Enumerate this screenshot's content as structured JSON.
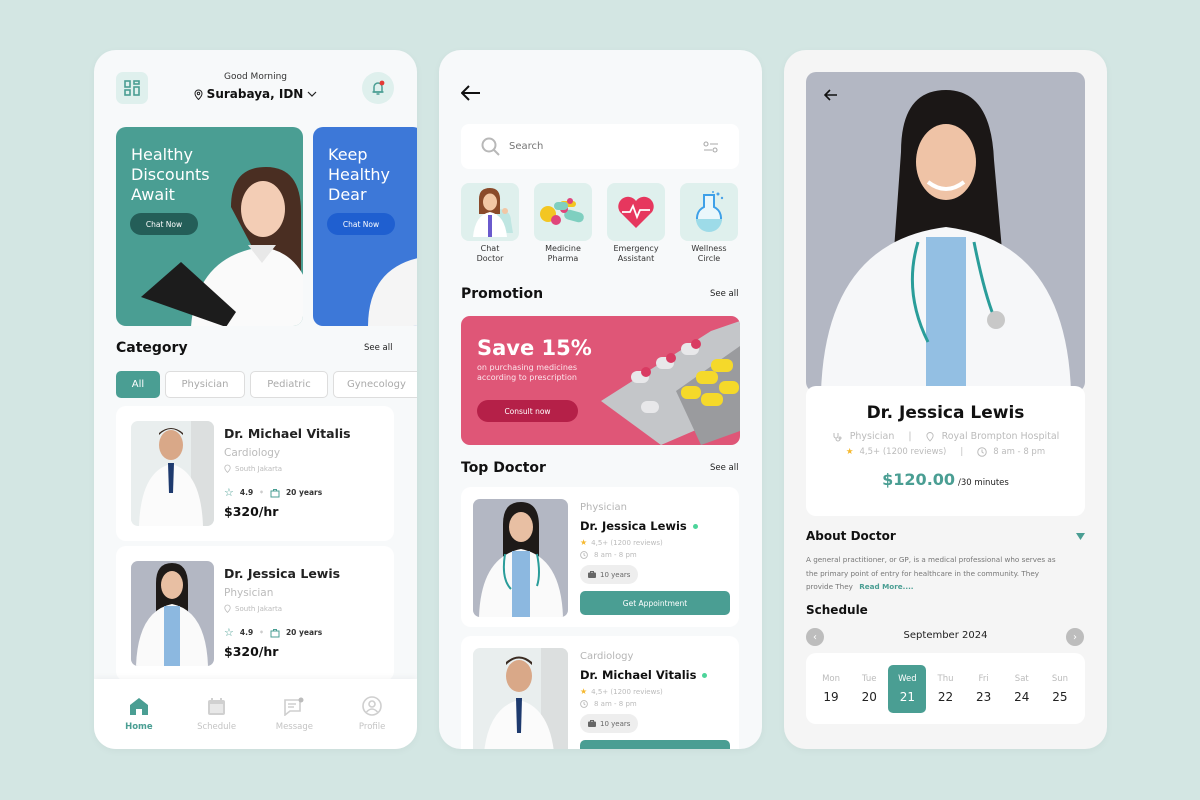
{
  "colors": {
    "background": "#d3e6e3",
    "primary": "#4a9e93",
    "blue_banner": "#3d78d8",
    "promo": "#df5677",
    "star": "#f5b82e",
    "online": "#4cd49a"
  },
  "home": {
    "greeting": "Good Morning",
    "location": "Surabaya, IDN",
    "banners": [
      {
        "title": "Healthy Discounts Await",
        "button": "Chat Now"
      },
      {
        "title": "Keep Healthy Dear",
        "button": "Chat Now"
      }
    ],
    "category_title": "Category",
    "see_all": "See all",
    "chips": [
      "All",
      "Physician",
      "Pediatric",
      "Gynecology"
    ],
    "doctors": [
      {
        "name": "Dr. Michael Vitalis",
        "specialty": "Cardiology",
        "location": "South Jakarta",
        "rating": "4.9",
        "experience": "20 years",
        "price": "$320/hr"
      },
      {
        "name": "Dr. Jessica Lewis",
        "specialty": "Physician",
        "location": "South Jakarta",
        "rating": "4.9",
        "experience": "20 years",
        "price": "$320/hr"
      }
    ],
    "nav": [
      {
        "label": "Home",
        "icon": "home-icon",
        "active": true
      },
      {
        "label": "Schedule",
        "icon": "calendar-icon"
      },
      {
        "label": "Message",
        "icon": "message-icon"
      },
      {
        "label": "Profile",
        "icon": "profile-icon"
      }
    ]
  },
  "search_screen": {
    "search_placeholder": "Search",
    "services": [
      {
        "line1": "Chat",
        "line2": "Doctor",
        "icon": "chat-doctor-icon"
      },
      {
        "line1": "Medicine",
        "line2": "Pharma",
        "icon": "pills-icon"
      },
      {
        "line1": "Emergency",
        "line2": "Assistant",
        "icon": "heart-pulse-icon"
      },
      {
        "line1": "Wellness",
        "line2": "Circle",
        "icon": "flask-icon"
      }
    ],
    "promotion_title": "Promotion",
    "see_all": "See all",
    "promo": {
      "headline": "Save 15%",
      "line1": "on purchasing medicines",
      "line2": "according to prescription",
      "button": "Consult now"
    },
    "top_doctor_title": "Top Doctor",
    "top_doctors": [
      {
        "specialty": "Physician",
        "name": "Dr. Jessica Lewis",
        "reviews": "4,5+ (1200 reviews)",
        "hours": "8 am - 8 pm",
        "experience": "10 years",
        "button": "Get Appointment"
      },
      {
        "specialty": "Cardiology",
        "name": "Dr. Michael Vitalis",
        "reviews": "4,5+ (1200 reviews)",
        "hours": "8 am - 8 pm",
        "experience": "10 years",
        "button": "Get Appointment"
      }
    ]
  },
  "detail": {
    "name": "Dr. Jessica Lewis",
    "specialty": "Physician",
    "hospital": "Royal Brompton Hospital",
    "reviews": "4,5+ (1200 reviews)",
    "hours": "8 am - 8 pm",
    "price": "$120.00",
    "price_unit": "/30 minutes",
    "about_title": "About Doctor",
    "about_text": "A general practitioner, or GP, is a medical professional who serves as the primary point of entry for healthcare in the community. They provide They",
    "read_more": "Read More....",
    "schedule_title": "Schedule",
    "month": "September 2024",
    "days": [
      {
        "name": "Mon",
        "date": "19"
      },
      {
        "name": "Tue",
        "date": "20"
      },
      {
        "name": "Wed",
        "date": "21",
        "selected": true
      },
      {
        "name": "Thu",
        "date": "22"
      },
      {
        "name": "Fri",
        "date": "23"
      },
      {
        "name": "Sat",
        "date": "24"
      },
      {
        "name": "Sun",
        "date": "25"
      }
    ]
  }
}
